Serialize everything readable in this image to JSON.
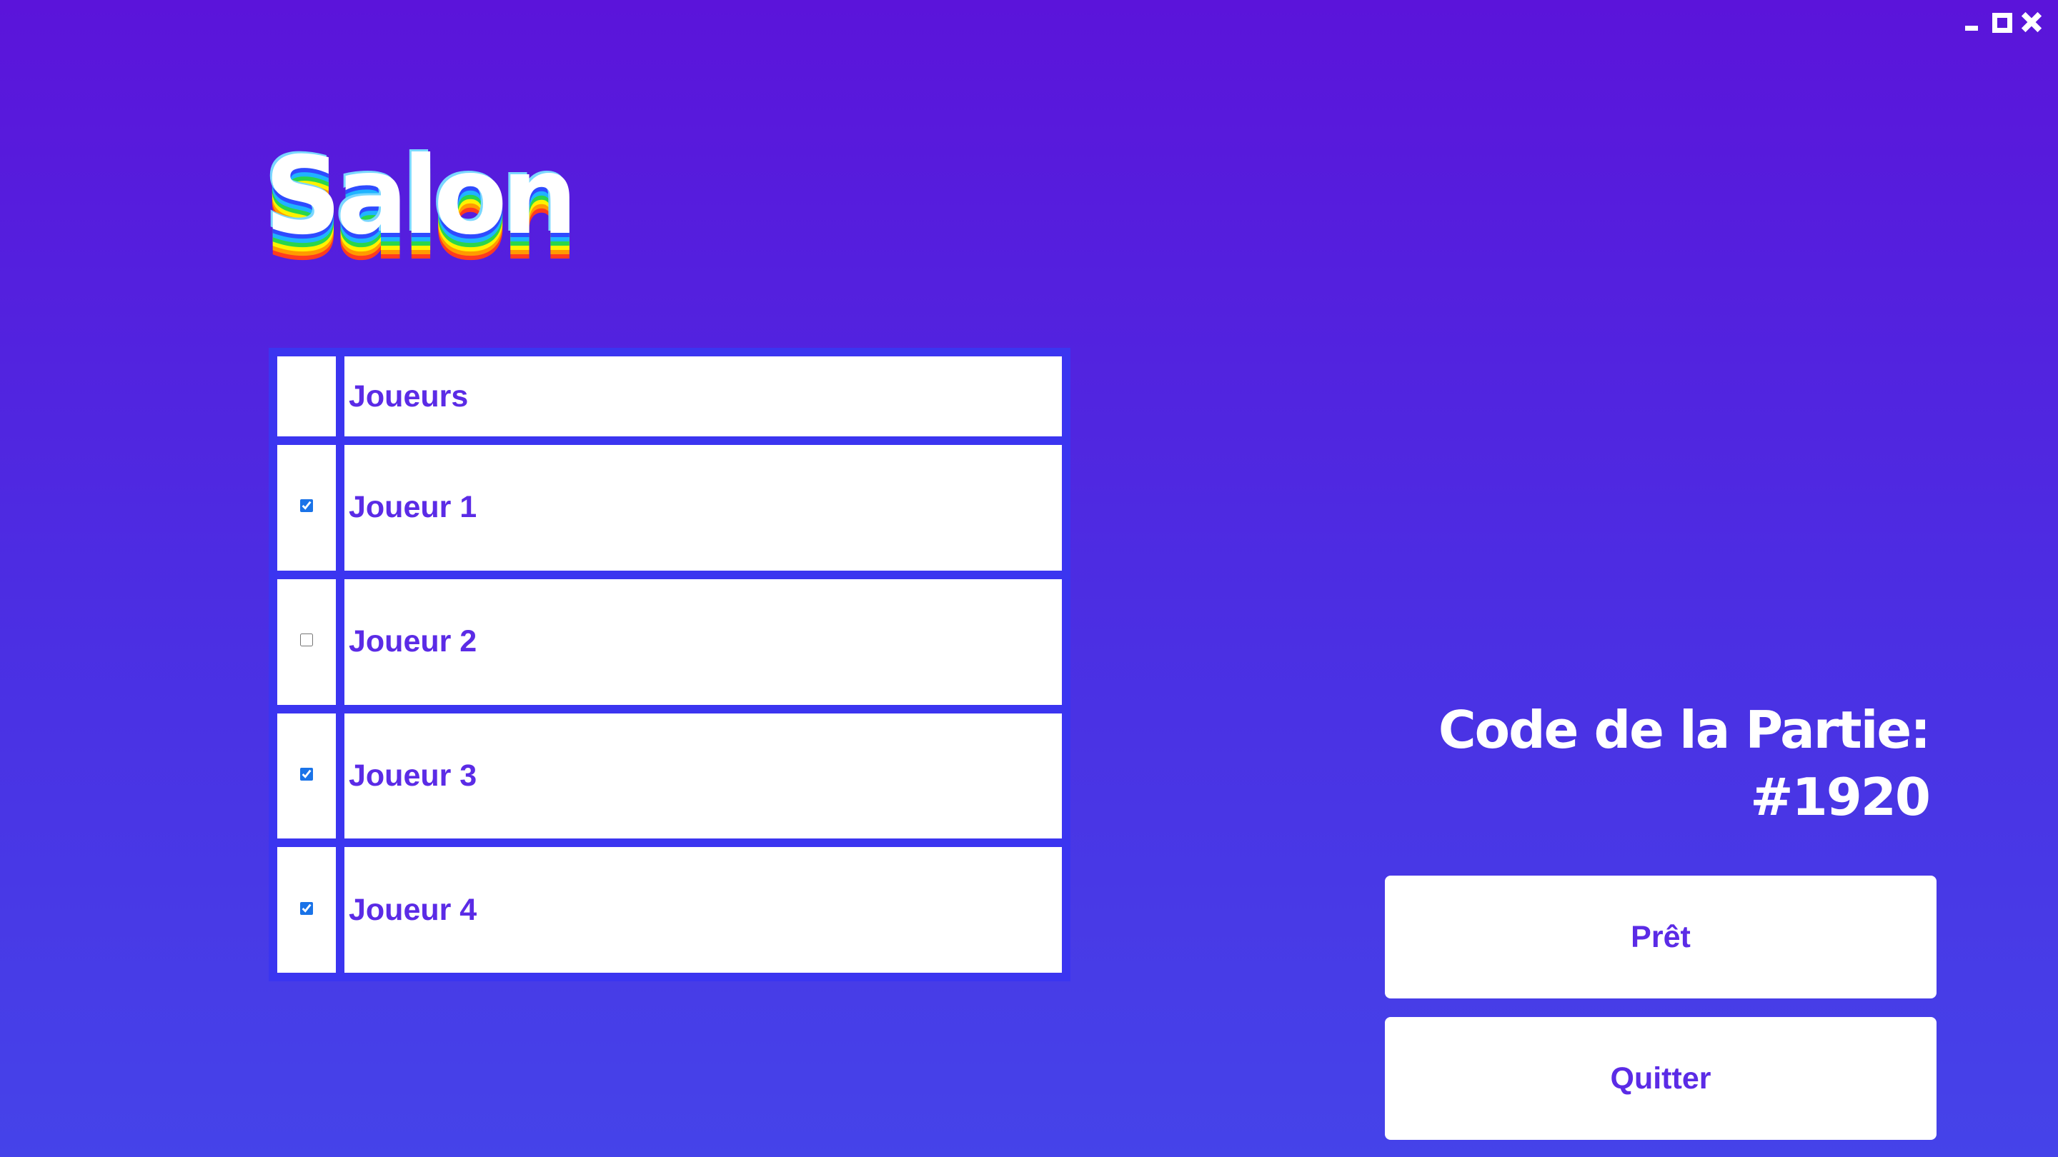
{
  "window_controls": {
    "minimize_icon": "minimize-icon",
    "maximize_icon": "maximize-icon",
    "close_icon": "close-icon"
  },
  "title": {
    "text": "Salon",
    "layer_colors": [
      "#ff3b1f",
      "#ff9b00",
      "#fff200",
      "#2ad64b",
      "#1fb4ff",
      "#2f4bff",
      "#7ad7ff"
    ]
  },
  "players_table": {
    "header": {
      "checkbox_column": "",
      "name_column": "Joueurs"
    },
    "rows": [
      {
        "name": "Joueur 1",
        "ready": true
      },
      {
        "name": "Joueur 2",
        "ready": false
      },
      {
        "name": "Joueur 3",
        "ready": true
      },
      {
        "name": "Joueur 4",
        "ready": true
      }
    ]
  },
  "game_code": {
    "label": "Code de la Partie:",
    "value": "#1920"
  },
  "buttons": {
    "ready_label": "Prêt",
    "quit_label": "Quitter"
  },
  "colors": {
    "background_top": "#5b14da",
    "background_bottom": "#4543e9",
    "table_border": "#3b35f0",
    "accent_text": "#5b2be6"
  }
}
